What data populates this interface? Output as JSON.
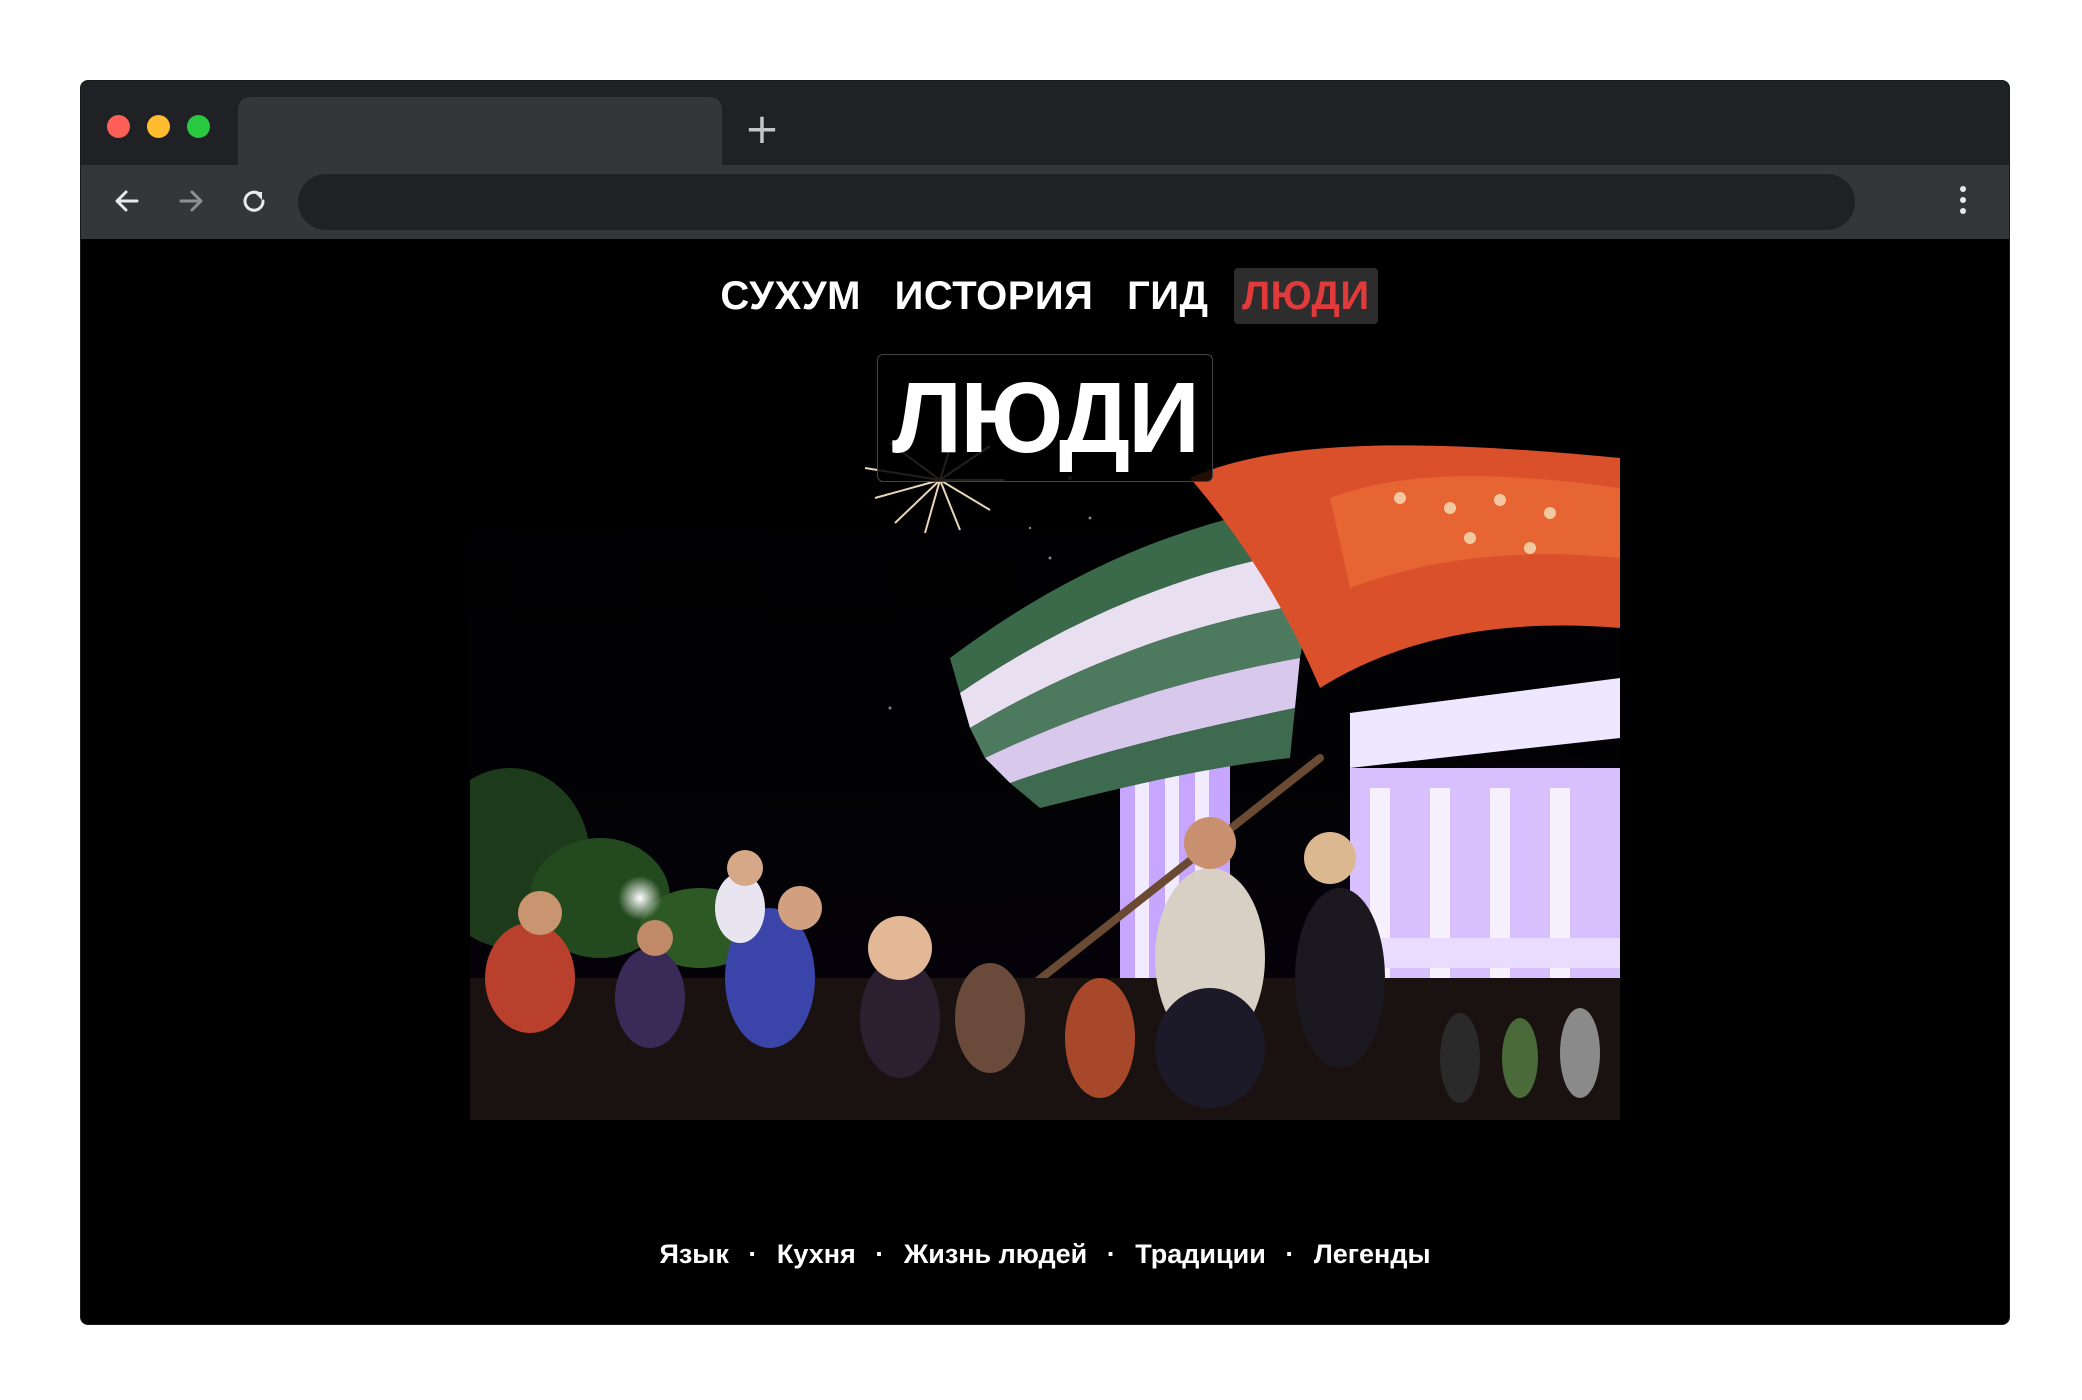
{
  "browser": {
    "tab_title": "",
    "new_tab_symbol": "+",
    "address": ""
  },
  "nav": {
    "items": [
      {
        "label": "СУХУМ",
        "active": false
      },
      {
        "label": "ИСТОРИЯ",
        "active": false
      },
      {
        "label": "ГИД",
        "active": false
      },
      {
        "label": "ЛЮДИ",
        "active": true
      }
    ]
  },
  "page": {
    "title": "ЛЮДИ"
  },
  "footer_links": {
    "items": [
      "Язык",
      "Кухня",
      "Жизнь людей",
      "Традиции",
      "Легенды"
    ],
    "separator": "·"
  },
  "colors": {
    "accent_active": "#e03a3a",
    "background": "#000000",
    "chrome_dark": "#202124",
    "chrome_mid": "#35363a"
  }
}
